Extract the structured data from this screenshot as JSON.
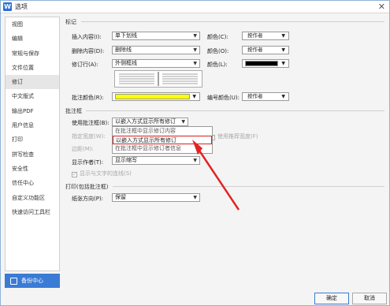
{
  "window": {
    "title": "选项",
    "app_icon": "W",
    "close_glyph": "✕"
  },
  "sidebar": {
    "items": [
      "视图",
      "编辑",
      "常规与保存",
      "文件位置",
      "修订",
      "中文版式",
      "输出PDF",
      "用户信息",
      "打印",
      "拼写检查",
      "安全性",
      "信任中心",
      "自定义功能区",
      "快速访问工具栏"
    ],
    "selected": "修订",
    "backup_label": "备份中心"
  },
  "markup": {
    "group_label": "标记",
    "insert": {
      "label": "插入内容(I):",
      "value": "单下划线",
      "color_label": "颜色(C):",
      "color_value": "按作者"
    },
    "delete": {
      "label": "删除内容(D):",
      "value": "删除线",
      "color_label": "颜色(O):",
      "color_value": "按作者"
    },
    "revline": {
      "label": "修订行(A):",
      "value": "外侧框线",
      "color_label": "颜色(L):",
      "color_swatch": "#000000"
    },
    "comment_color": {
      "label": "批注颜色(R):",
      "swatch": "#ffff00",
      "number_color_label": "编号颜色(U):",
      "number_color_value": "按作者"
    }
  },
  "balloons": {
    "group_label": "批注框",
    "use_label": "使用批注框(B):",
    "use_value": "以嵌入方式显示所有修订",
    "width_label": "指定宽度(W):",
    "recommended_label": "使用推荐宽度(F)",
    "margin_label": "边距(M):",
    "author_label": "显示作者(T):",
    "author_value": "显示缩写",
    "lines_label": "显示与文字的连线(S)",
    "options": [
      "在批注框中显示修订内容",
      "以嵌入方式显示所有修订",
      "在批注框中显示修订者信息"
    ],
    "highlighted_option": "以嵌入方式显示所有修订"
  },
  "print": {
    "group_label": "打印(包括批注框)",
    "orientation_label": "纸张方向(P):",
    "orientation_value": "保留"
  },
  "footer": {
    "ok": "确定",
    "cancel": "取消"
  },
  "accent_color": "#3a7bd5",
  "annotation_color": "#e02424"
}
